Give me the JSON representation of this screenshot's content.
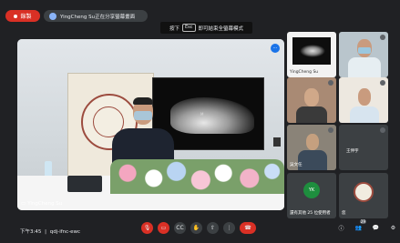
{
  "recording": {
    "label": "錄製"
  },
  "presenting": {
    "text": "YingCheng Su正在分享螢幕畫面"
  },
  "fullscreen_hint": {
    "before": "按下",
    "key": "Esc",
    "after": "即可結束全螢幕模式"
  },
  "main_video": {
    "participant": "YingCheng Su",
    "xray_label": "M"
  },
  "participants": [
    {
      "name": "YingCheng Su"
    },
    {
      "name": ""
    },
    {
      "name": ""
    },
    {
      "name": ""
    },
    {
      "name": "吳文任"
    },
    {
      "name": "王伸宇"
    },
    {
      "name": "還有其他 25 位使用者",
      "avatar_initials": "YK"
    },
    {
      "name": "您"
    }
  ],
  "bottom_bar": {
    "time": "下午3:45",
    "meeting_code": "qdj-ifnc-ewc",
    "people_count": "29"
  },
  "colors": {
    "accent": "#1a73e8",
    "danger": "#d93025",
    "background": "#202124"
  }
}
